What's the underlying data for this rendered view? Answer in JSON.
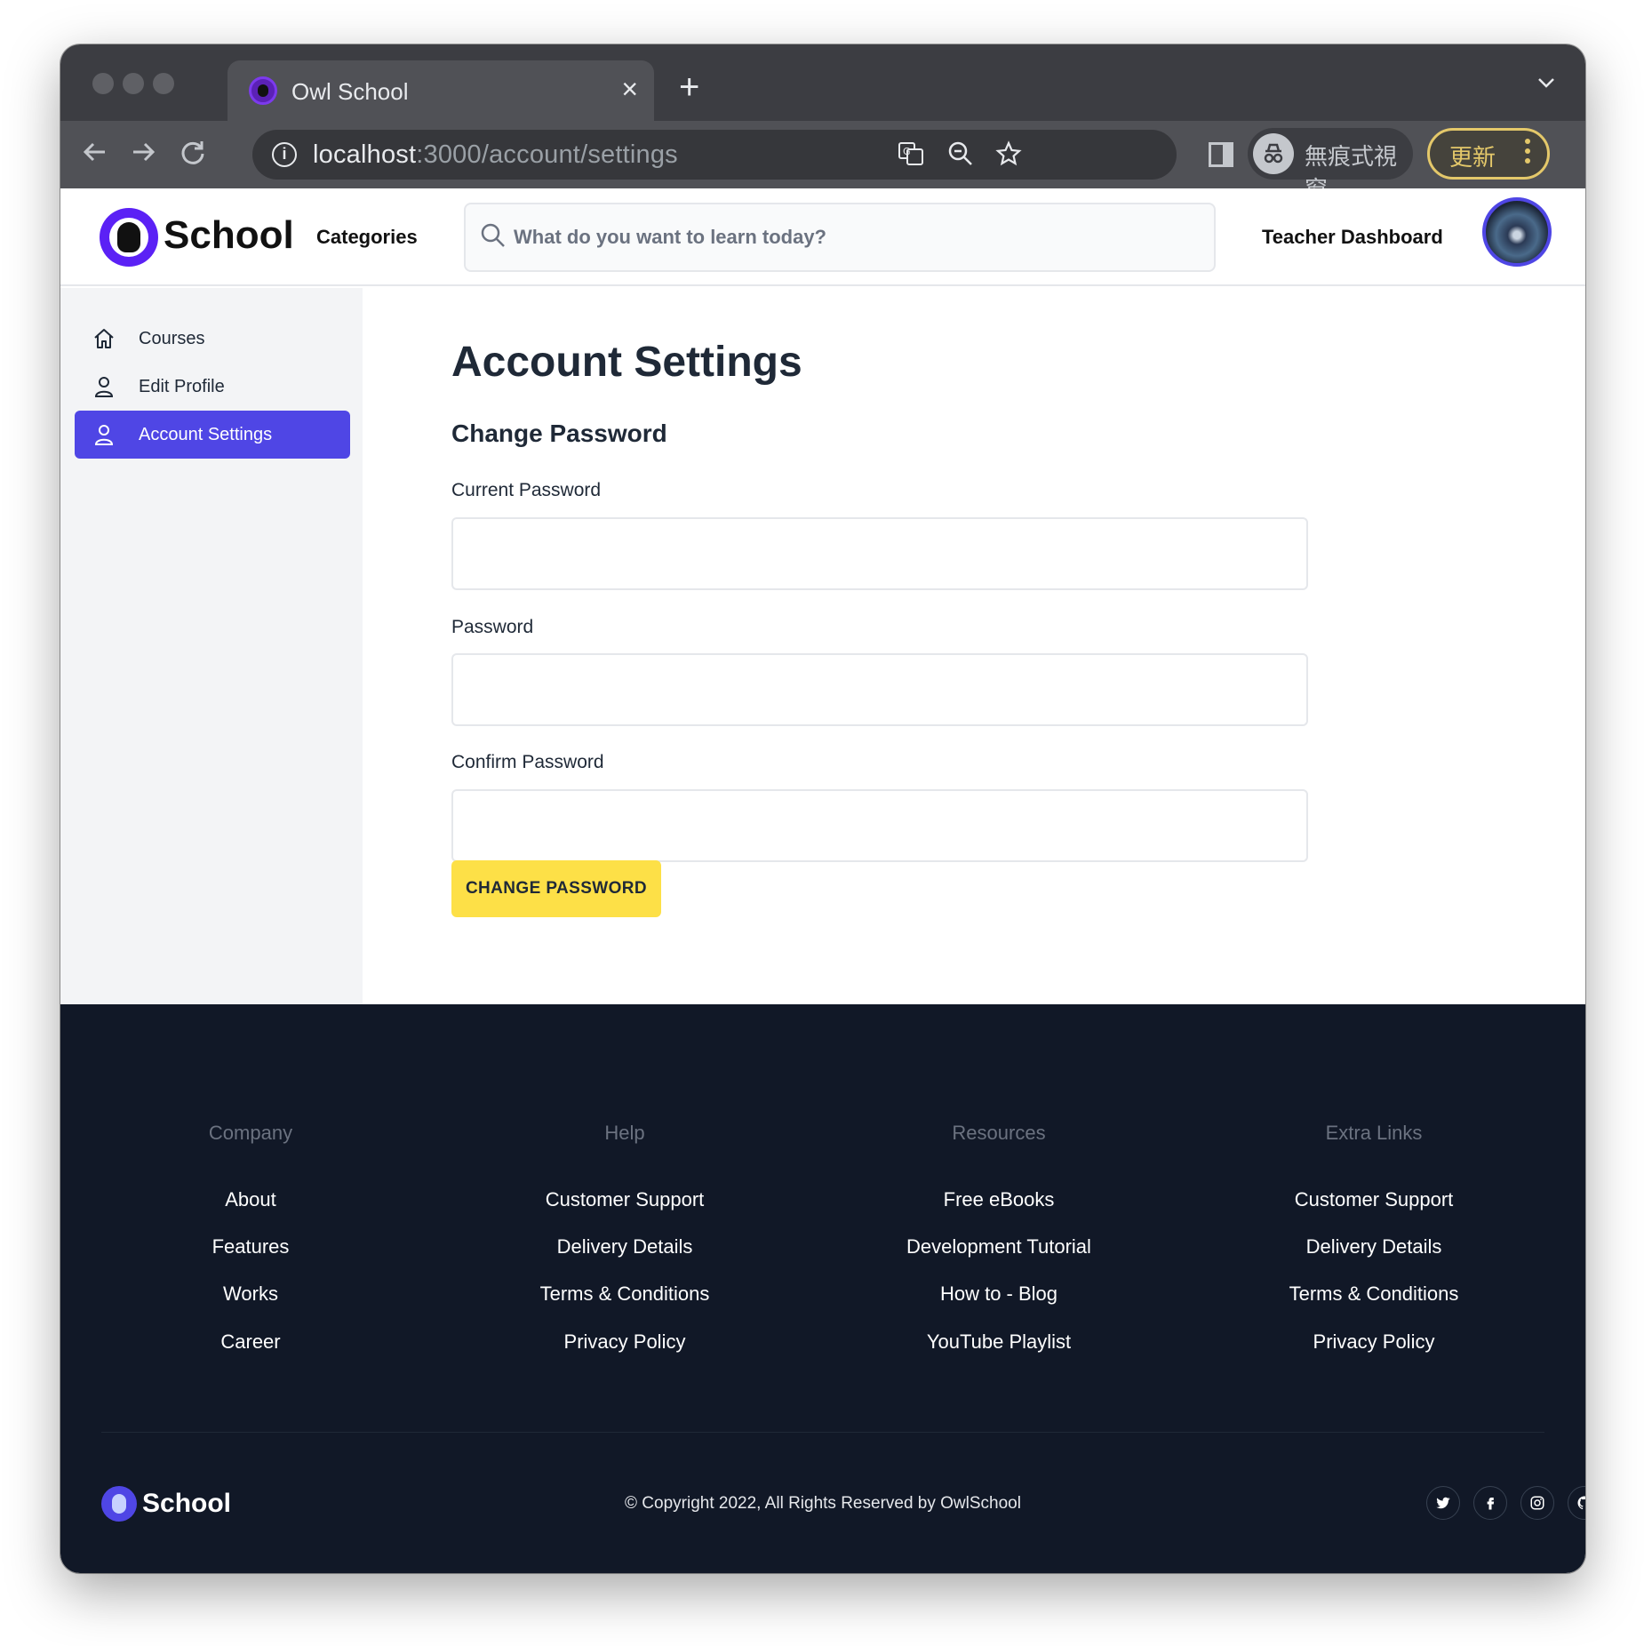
{
  "browser": {
    "tab_title": "Owl School",
    "tab_close": "×",
    "new_tab": "+",
    "url_host": "localhost",
    "url_path": ":3000/account/settings",
    "incognito_label": "無痕式視窗",
    "update_label": "更新",
    "icons": [
      "back-icon",
      "forward-icon",
      "reload-icon",
      "info-icon",
      "translate-icon",
      "zoom-icon",
      "star-icon",
      "side-panel-icon",
      "incognito-icon",
      "menu-icon"
    ]
  },
  "header": {
    "logo_text": "School",
    "categories": "Categories",
    "search_placeholder": "What do you want to learn today?",
    "teacher_dashboard": "Teacher Dashboard"
  },
  "sidebar": {
    "items": [
      {
        "label": "Courses",
        "icon": "home-icon",
        "active": false
      },
      {
        "label": "Edit Profile",
        "icon": "user-icon",
        "active": false
      },
      {
        "label": "Account Settings",
        "icon": "user-icon",
        "active": true
      }
    ],
    "active_color": "#4f46e5"
  },
  "main": {
    "title": "Account Settings",
    "subtitle": "Change Password",
    "fields": [
      {
        "label": "Current Password",
        "value": ""
      },
      {
        "label": "Password",
        "value": ""
      },
      {
        "label": "Confirm Password",
        "value": ""
      }
    ],
    "button_label": "CHANGE PASSWORD",
    "button_color": "#fde047"
  },
  "footer": {
    "columns": [
      {
        "heading": "Company",
        "links": [
          "About",
          "Features",
          "Works",
          "Career"
        ]
      },
      {
        "heading": "Help",
        "links": [
          "Customer Support",
          "Delivery Details",
          "Terms & Conditions",
          "Privacy Policy"
        ]
      },
      {
        "heading": "Resources",
        "links": [
          "Free eBooks",
          "Development Tutorial",
          "How to - Blog",
          "YouTube Playlist"
        ]
      },
      {
        "heading": "Extra Links",
        "links": [
          "Customer Support",
          "Delivery Details",
          "Terms & Conditions",
          "Privacy Policy"
        ]
      }
    ],
    "logo_text": "School",
    "copyright": "© Copyright 2022, All Rights Reserved by OwlSchool",
    "social": [
      "twitter-icon",
      "facebook-icon",
      "instagram-icon",
      "github-icon"
    ],
    "background": "#111827"
  }
}
